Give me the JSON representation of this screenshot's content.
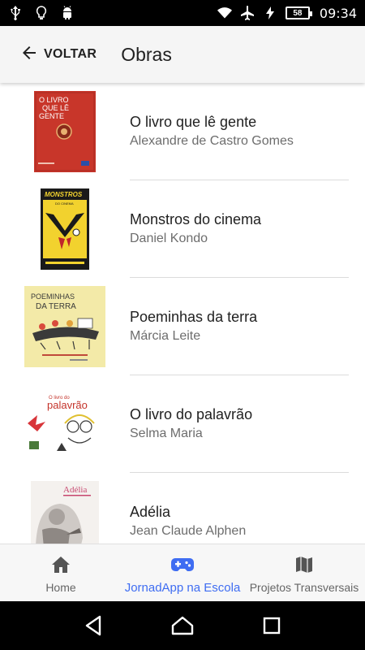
{
  "status_bar": {
    "battery": "58",
    "time": "09:34",
    "icons_left": [
      "usb-icon",
      "bulb-icon",
      "android-icon"
    ],
    "icons_right": [
      "wifi-icon",
      "airplane-icon",
      "charging-icon",
      "battery-icon"
    ]
  },
  "app_bar": {
    "back_label": "VOLTAR",
    "title": "Obras"
  },
  "books": [
    {
      "title": "O livro que lê gente",
      "author": "Alexandre de Castro Gomes",
      "cover": {
        "text1": "O LIVRO",
        "text2": "QUE LÊ",
        "text3": "GENTE",
        "color": "#c8362a"
      }
    },
    {
      "title": "Monstros do cinema",
      "author": "Daniel Kondo",
      "cover": {
        "text1": "MONSTROS",
        "text2": "DO CINEMA",
        "color": "#f2d22e"
      }
    },
    {
      "title": "Poeminhas da terra",
      "author": "Márcia Leite",
      "cover": {
        "text1": "POEMINHAS",
        "text2": "DA TERRA",
        "color": "#f3eaa8"
      }
    },
    {
      "title": "O livro do palavrão",
      "author": "Selma Maria",
      "cover": {
        "text1": "O livro do",
        "text2": "palavrão",
        "color": "#ffffff"
      }
    },
    {
      "title": "Adélia",
      "author": "Jean Claude Alphen",
      "cover": {
        "text1": "Adélia",
        "color": "#f4f1ee"
      }
    }
  ],
  "bottom_nav": [
    {
      "label": "Home",
      "icon": "home-icon",
      "active": false
    },
    {
      "label": "JornadApp na Escola",
      "icon": "gamepad-icon",
      "active": true
    },
    {
      "label": "Projetos Transversais",
      "icon": "map-icon",
      "active": false
    }
  ],
  "colors": {
    "accent": "#3f6df2",
    "app_bar": "#f5f5f5",
    "divider": "#dcdcdc",
    "author_text": "#6d6d6d"
  }
}
